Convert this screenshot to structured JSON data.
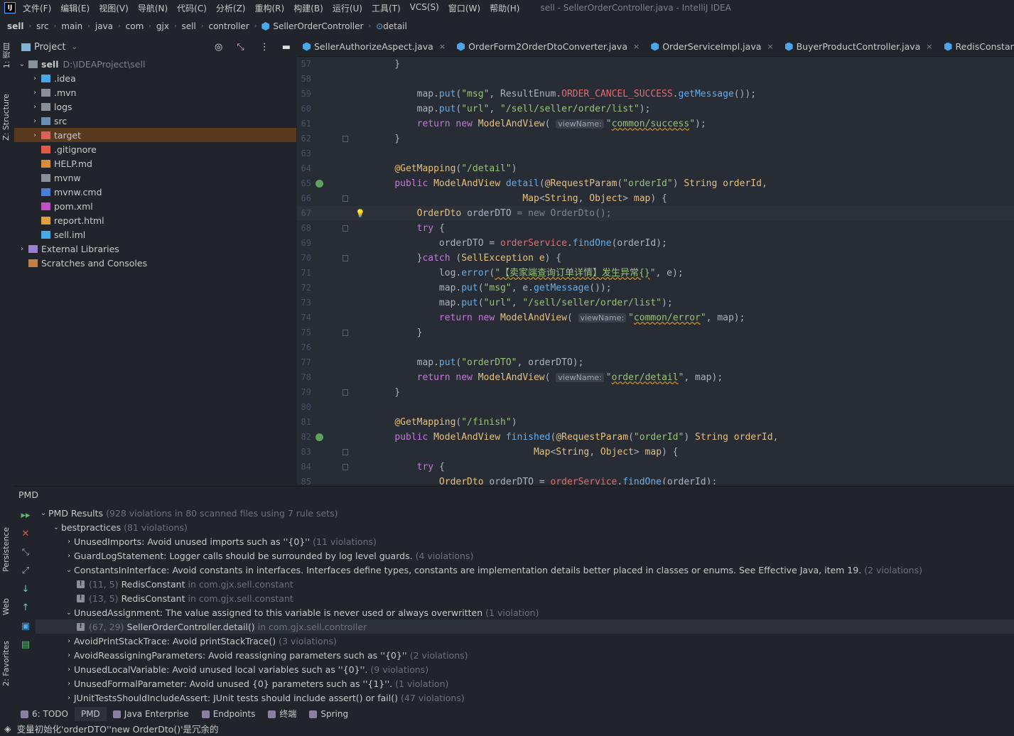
{
  "menubar": {
    "items": [
      "文件(F)",
      "编辑(E)",
      "视图(V)",
      "导航(N)",
      "代码(C)",
      "分析(Z)",
      "重构(R)",
      "构建(B)",
      "运行(U)",
      "工具(T)",
      "VCS(S)",
      "窗口(W)",
      "帮助(H)"
    ],
    "title": "sell - SellerOrderController.java - IntelliJ IDEA",
    "logo": "IJ"
  },
  "breadcrumb": [
    "sell",
    "src",
    "main",
    "java",
    "com",
    "gjx",
    "sell",
    "controller",
    "SellerOrderController",
    "detail"
  ],
  "left_strip": {
    "project": "1: 项目",
    "structure": "Z: Structure",
    "persistence": "Persistence",
    "web": "Web",
    "favorites": "2: Favorites"
  },
  "project": {
    "title": "Project",
    "tree": [
      {
        "name": "sell",
        "extra": "D:\\IDEAProject\\sell",
        "depth": 0,
        "arrow": "down",
        "icon": "folder"
      },
      {
        "name": ".idea",
        "depth": 1,
        "arrow": "right",
        "icon": "folder-blue"
      },
      {
        "name": ".mvn",
        "depth": 1,
        "arrow": "right",
        "icon": "folder"
      },
      {
        "name": "logs",
        "depth": 1,
        "arrow": "right",
        "icon": "folder"
      },
      {
        "name": "src",
        "depth": 1,
        "arrow": "right",
        "icon": "folder-src"
      },
      {
        "name": "target",
        "depth": 1,
        "arrow": "right",
        "icon": "folder-orange",
        "selected": true
      },
      {
        "name": ".gitignore",
        "depth": 1,
        "icon": "git"
      },
      {
        "name": "HELP.md",
        "depth": 1,
        "icon": "md"
      },
      {
        "name": "mvnw",
        "depth": 1,
        "icon": "file"
      },
      {
        "name": "mvnw.cmd",
        "depth": 1,
        "icon": "cmd"
      },
      {
        "name": "pom.xml",
        "depth": 1,
        "icon": "maven"
      },
      {
        "name": "report.html",
        "depth": 1,
        "icon": "html"
      },
      {
        "name": "sell.iml",
        "depth": 1,
        "icon": "iml"
      },
      {
        "name": "External Libraries",
        "depth": 0,
        "arrow": "right",
        "icon": "lib"
      },
      {
        "name": "Scratches and Consoles",
        "depth": 0,
        "icon": "scratch"
      }
    ]
  },
  "tabs": [
    "SellerAuthorizeAspect.java",
    "OrderForm2OrderDtoConverter.java",
    "OrderServiceImpl.java",
    "BuyerProductController.java",
    "RedisConstant.java"
  ],
  "editor": {
    "current_line": 67,
    "lines": [
      {
        "n": "57",
        "t": [
          [
            "p",
            "    }"
          ]
        ]
      },
      {
        "n": "58",
        "t": []
      },
      {
        "n": "59",
        "t": [
          [
            "p",
            "        map."
          ],
          [
            "m",
            "put"
          ],
          [
            "p",
            "("
          ],
          [
            "s",
            "\"msg\""
          ],
          [
            "p",
            ", ResultEnum."
          ],
          [
            "f",
            "ORDER_CANCEL_SUCCESS"
          ],
          [
            "p",
            "."
          ],
          [
            "m",
            "getMessage"
          ],
          [
            "p",
            "());"
          ]
        ]
      },
      {
        "n": "60",
        "t": [
          [
            "p",
            "        map."
          ],
          [
            "m",
            "put"
          ],
          [
            "p",
            "("
          ],
          [
            "s",
            "\"url\""
          ],
          [
            "p",
            ", "
          ],
          [
            "s",
            "\"/sell/seller/order/list\""
          ],
          [
            "p",
            ");"
          ]
        ]
      },
      {
        "n": "61",
        "t": [
          [
            "p",
            "        "
          ],
          [
            "k",
            "return new "
          ],
          [
            "t",
            "ModelAndView"
          ],
          [
            "p",
            "( "
          ],
          [
            "h",
            "viewName:"
          ],
          [
            "s",
            "\""
          ],
          [
            "su",
            "common/success"
          ],
          [
            "s",
            "\""
          ],
          [
            "p",
            ");"
          ]
        ]
      },
      {
        "n": "62",
        "t": [
          [
            "p",
            "    }"
          ]
        ]
      },
      {
        "n": "63",
        "t": []
      },
      {
        "n": "64",
        "t": [
          [
            "p",
            "    "
          ],
          [
            "a",
            "@GetMapping"
          ],
          [
            "p",
            "("
          ],
          [
            "s",
            "\"/detail\""
          ],
          [
            "p",
            ")"
          ]
        ]
      },
      {
        "n": "65",
        "t": [
          [
            "p",
            "    "
          ],
          [
            "k",
            "public "
          ],
          [
            "t",
            "ModelAndView "
          ],
          [
            "m",
            "detail"
          ],
          [
            "p",
            "("
          ],
          [
            "a",
            "@RequestParam"
          ],
          [
            "p",
            "("
          ],
          [
            "s",
            "\"orderId\""
          ],
          [
            "p",
            ") "
          ],
          [
            "t",
            "String "
          ],
          [
            "t",
            "orderId"
          ],
          [
            "p",
            ","
          ]
        ]
      },
      {
        "n": "66",
        "t": [
          [
            "p",
            "                           "
          ],
          [
            "t",
            "Map"
          ],
          [
            "p",
            "<"
          ],
          [
            "t",
            "String"
          ],
          [
            "p",
            ", "
          ],
          [
            "t",
            "Object"
          ],
          [
            "p",
            "> "
          ],
          [
            "t",
            "map"
          ],
          [
            "p",
            ") {"
          ]
        ]
      },
      {
        "n": "67",
        "t": [
          [
            "p",
            "        "
          ],
          [
            "t",
            "OrderDto "
          ],
          [
            "p",
            "orderDTO "
          ],
          [
            "g",
            "= new OrderDto();"
          ]
        ]
      },
      {
        "n": "68",
        "t": [
          [
            "p",
            "        "
          ],
          [
            "k",
            "try "
          ],
          [
            "p",
            "{"
          ]
        ]
      },
      {
        "n": "69",
        "t": [
          [
            "p",
            "            orderDTO = "
          ],
          [
            "f",
            "orderService"
          ],
          [
            "p",
            "."
          ],
          [
            "m",
            "findOne"
          ],
          [
            "p",
            "(orderId);"
          ]
        ]
      },
      {
        "n": "70",
        "t": [
          [
            "p",
            "        }"
          ],
          [
            "k",
            "catch "
          ],
          [
            "p",
            "("
          ],
          [
            "t",
            "SellException "
          ],
          [
            "t",
            "e"
          ],
          [
            "p",
            ") {"
          ]
        ]
      },
      {
        "n": "71",
        "t": [
          [
            "p",
            "            log."
          ],
          [
            "m",
            "error"
          ],
          [
            "p",
            "("
          ],
          [
            "su",
            "\"【卖家端查询订单详情】发生异常{}"
          ],
          [
            "s",
            "\""
          ],
          [
            "p",
            ", e);"
          ]
        ]
      },
      {
        "n": "72",
        "t": [
          [
            "p",
            "            map."
          ],
          [
            "m",
            "put"
          ],
          [
            "p",
            "("
          ],
          [
            "s",
            "\"msg\""
          ],
          [
            "p",
            ", e."
          ],
          [
            "m",
            "getMessage"
          ],
          [
            "p",
            "());"
          ]
        ]
      },
      {
        "n": "73",
        "t": [
          [
            "p",
            "            map."
          ],
          [
            "m",
            "put"
          ],
          [
            "p",
            "("
          ],
          [
            "s",
            "\"url\""
          ],
          [
            "p",
            ", "
          ],
          [
            "s",
            "\"/sell/seller/order/list\""
          ],
          [
            "p",
            ");"
          ]
        ]
      },
      {
        "n": "74",
        "t": [
          [
            "p",
            "            "
          ],
          [
            "k",
            "return new "
          ],
          [
            "t",
            "ModelAndView"
          ],
          [
            "p",
            "( "
          ],
          [
            "h",
            "viewName:"
          ],
          [
            "s",
            "\""
          ],
          [
            "su",
            "common/error"
          ],
          [
            "s",
            "\""
          ],
          [
            "p",
            ", map);"
          ]
        ]
      },
      {
        "n": "75",
        "t": [
          [
            "p",
            "        }"
          ]
        ]
      },
      {
        "n": "76",
        "t": []
      },
      {
        "n": "77",
        "t": [
          [
            "p",
            "        map."
          ],
          [
            "m",
            "put"
          ],
          [
            "p",
            "("
          ],
          [
            "s",
            "\"orderDTO\""
          ],
          [
            "p",
            ", orderDTO);"
          ]
        ]
      },
      {
        "n": "78",
        "t": [
          [
            "p",
            "        "
          ],
          [
            "k",
            "return new "
          ],
          [
            "t",
            "ModelAndView"
          ],
          [
            "p",
            "( "
          ],
          [
            "h",
            "viewName:"
          ],
          [
            "s",
            "\""
          ],
          [
            "su",
            "order/detail"
          ],
          [
            "s",
            "\""
          ],
          [
            "p",
            ", map);"
          ]
        ]
      },
      {
        "n": "79",
        "t": [
          [
            "p",
            "    }"
          ]
        ]
      },
      {
        "n": "80",
        "t": []
      },
      {
        "n": "81",
        "t": [
          [
            "p",
            "    "
          ],
          [
            "a",
            "@GetMapping"
          ],
          [
            "p",
            "("
          ],
          [
            "s",
            "\"/finish\""
          ],
          [
            "p",
            ")"
          ]
        ]
      },
      {
        "n": "82",
        "t": [
          [
            "p",
            "    "
          ],
          [
            "k",
            "public "
          ],
          [
            "t",
            "ModelAndView "
          ],
          [
            "m",
            "finished"
          ],
          [
            "p",
            "("
          ],
          [
            "a",
            "@RequestParam"
          ],
          [
            "p",
            "("
          ],
          [
            "s",
            "\"orderId\""
          ],
          [
            "p",
            ") "
          ],
          [
            "t",
            "String "
          ],
          [
            "t",
            "orderId"
          ],
          [
            "p",
            ","
          ]
        ]
      },
      {
        "n": "83",
        "t": [
          [
            "p",
            "                             "
          ],
          [
            "t",
            "Map"
          ],
          [
            "p",
            "<"
          ],
          [
            "t",
            "String"
          ],
          [
            "p",
            ", "
          ],
          [
            "t",
            "Object"
          ],
          [
            "p",
            "> "
          ],
          [
            "t",
            "map"
          ],
          [
            "p",
            ") {"
          ]
        ]
      },
      {
        "n": "84",
        "t": [
          [
            "p",
            "        "
          ],
          [
            "k",
            "try "
          ],
          [
            "p",
            "{"
          ]
        ]
      },
      {
        "n": "85",
        "t": [
          [
            "p",
            "            "
          ],
          [
            "t",
            "OrderDto "
          ],
          [
            "p",
            "orderDTO = "
          ],
          [
            "f",
            "orderService"
          ],
          [
            "p",
            "."
          ],
          [
            "m",
            "findOne"
          ],
          [
            "p",
            "(orderId);"
          ]
        ]
      }
    ]
  },
  "pmd": {
    "title": "PMD",
    "rows": [
      {
        "depth": 0,
        "arrow": "down",
        "text": "PMD Results",
        "dim": "(928 violations in 80 scanned files using 7 rule sets)"
      },
      {
        "depth": 1,
        "arrow": "down",
        "text": "bestpractices",
        "dim": "(81 violations)"
      },
      {
        "depth": 2,
        "arrow": "right",
        "text": "UnusedImports: Avoid unused imports such as ''{0}''",
        "dim": "(11 violations)"
      },
      {
        "depth": 2,
        "arrow": "right",
        "text": "GuardLogStatement: Logger calls should be surrounded by log level guards.",
        "dim": "(4 violations)"
      },
      {
        "depth": 2,
        "arrow": "down",
        "text": "ConstantsInInterface: Avoid constants in interfaces. Interfaces define types, constants are implementation details better placed in classes or enums. See Effective Java, item 19.",
        "dim": "(2 violations)"
      },
      {
        "depth": 3,
        "warn": true,
        "pos": "(11, 5)",
        "text": "RedisConstant",
        "dim": "in com.gjx.sell.constant"
      },
      {
        "depth": 3,
        "warn": true,
        "pos": "(13, 5)",
        "text": "RedisConstant",
        "dim": "in com.gjx.sell.constant"
      },
      {
        "depth": 2,
        "arrow": "down",
        "text": "UnusedAssignment: The value assigned to this variable is never used or always overwritten",
        "dim": "(1 violation)"
      },
      {
        "depth": 3,
        "warn": true,
        "pos": "(67, 29)",
        "text": "SellerOrderController.detail()",
        "dim": "in com.gjx.sell.controller",
        "selected": true
      },
      {
        "depth": 2,
        "arrow": "right",
        "text": "AvoidPrintStackTrace: Avoid printStackTrace()",
        "dim": "(3 violations)"
      },
      {
        "depth": 2,
        "arrow": "right",
        "text": "AvoidReassigningParameters: Avoid reassigning parameters such as ''{0}''",
        "dim": "(2 violations)"
      },
      {
        "depth": 2,
        "arrow": "right",
        "text": "UnusedLocalVariable: Avoid unused local variables such as ''{0}''.",
        "dim": "(9 violations)"
      },
      {
        "depth": 2,
        "arrow": "right",
        "text": "UnusedFormalParameter: Avoid unused {0} parameters such as ''{1}''.",
        "dim": "(1 violation)"
      },
      {
        "depth": 2,
        "arrow": "right",
        "text": "JUnitTestsShouldIncludeAssert: JUnit tests should include assert() or fail()",
        "dim": "(47 violations)"
      }
    ]
  },
  "bottom_tabs": [
    {
      "label": "6: TODO",
      "icon": "todo-icon"
    },
    {
      "label": "PMD",
      "active": true
    },
    {
      "label": "Java Enterprise",
      "icon": "java-enterprise-icon"
    },
    {
      "label": "Endpoints",
      "icon": "globe-icon"
    },
    {
      "label": "终端",
      "icon": "terminal-icon"
    },
    {
      "label": "Spring",
      "icon": "spring-icon"
    }
  ],
  "status": "变量初始化'orderDTO''new OrderDto()'是冗余的",
  "colors": {
    "keyword": "#c678dd",
    "type": "#e5c07b",
    "method": "#61afef",
    "field": "#e06c75",
    "string": "#98c379",
    "editor_bg": "#282c34",
    "selection": "#5a3a1f"
  }
}
